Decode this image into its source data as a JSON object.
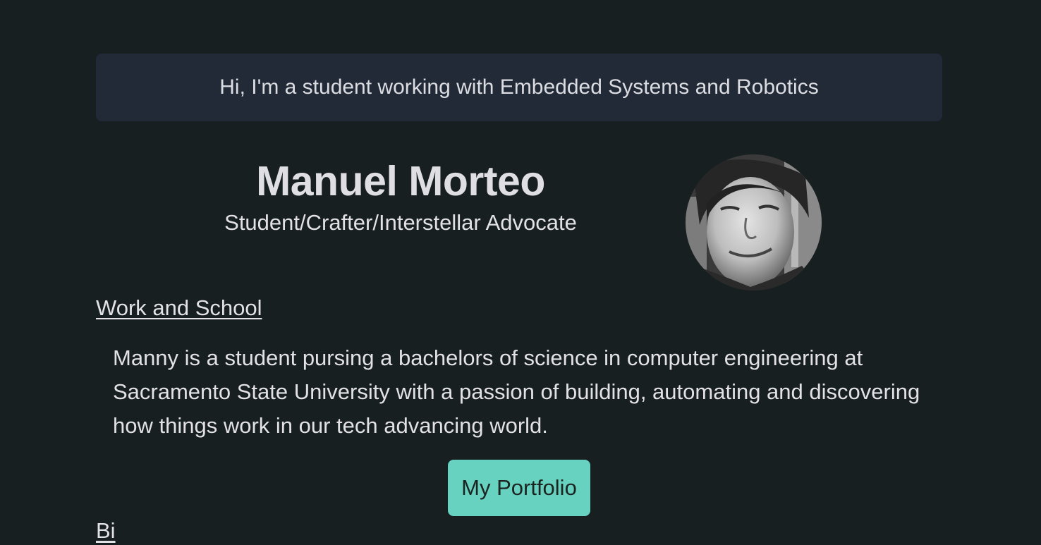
{
  "banner": {
    "text": "Hi, I'm a student working with Embedded Systems and Robotics"
  },
  "profile": {
    "name": "Manuel Morteo",
    "tagline": "Student/Crafter/Interstellar Advocate",
    "avatar_icon": "profile-photo"
  },
  "work_school": {
    "heading": "Work and School",
    "bio": "Manny is a student pursing a bachelors of science in computer engineering at Sacramento State University with a passion of building, automating and discovering how things work in our tech advancing world.",
    "button_label": "My Portfolio"
  },
  "next_section": {
    "heading": "Bi"
  },
  "colors": {
    "background": "#181f20",
    "banner": "#212a36",
    "accent": "#67d2bf",
    "text": "#e2e2e6"
  }
}
